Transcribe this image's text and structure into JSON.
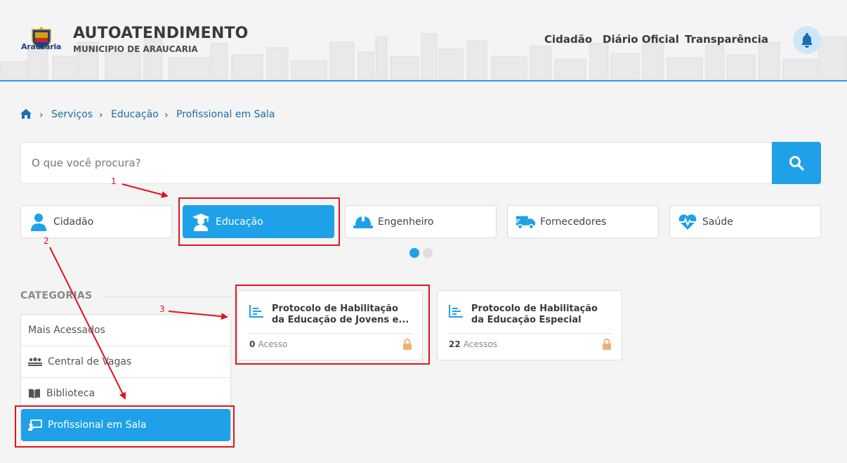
{
  "header": {
    "logo_text": "Araucária",
    "title": "AUTOATENDIMENTO",
    "subtitle": "MUNICIPIO DE ARAUCARIA",
    "nav": [
      "Cidadão",
      "Diário Oficial",
      "Transparência"
    ],
    "bell_icon": "bell-icon"
  },
  "breadcrumb": [
    "Serviços",
    "Educação",
    "Profissional em Sala"
  ],
  "search": {
    "placeholder": "O que você procura?",
    "value": "",
    "button_icon": "search-icon"
  },
  "profiles": [
    {
      "label": "Cidadão",
      "icon": "person-icon",
      "active": false
    },
    {
      "label": "Educação",
      "icon": "graduate-icon",
      "active": true
    },
    {
      "label": "Engenheiro",
      "icon": "hardhat-icon",
      "active": false
    },
    {
      "label": "Fornecedores",
      "icon": "truck-icon",
      "active": false
    },
    {
      "label": "Saúde",
      "icon": "heart-pulse-icon",
      "active": false
    }
  ],
  "carousel_pages": 2,
  "carousel_active": 1,
  "categories": {
    "title": "CATEGORIAS",
    "items": [
      "Mais Acessados",
      "Central de Vagas",
      "Biblioteca",
      "Profissional em Sala"
    ],
    "active": "Profissional em Sala"
  },
  "services": [
    {
      "title": "Protocolo de Habilitação da Educação de Jovens e...",
      "count": "0",
      "unit": "Acesso",
      "icon": "chart-icon",
      "lock_icon": "lock-icon"
    },
    {
      "title": "Protocolo de Habilitação da Educação Especial",
      "count": "22",
      "unit": "Acessos",
      "icon": "chart-icon",
      "lock_icon": "lock-icon"
    }
  ],
  "annotations": [
    "1",
    "2",
    "3"
  ],
  "colors": {
    "accent": "#1ea1e8",
    "annotation": "#e0141e",
    "lock": "#f0b070"
  }
}
